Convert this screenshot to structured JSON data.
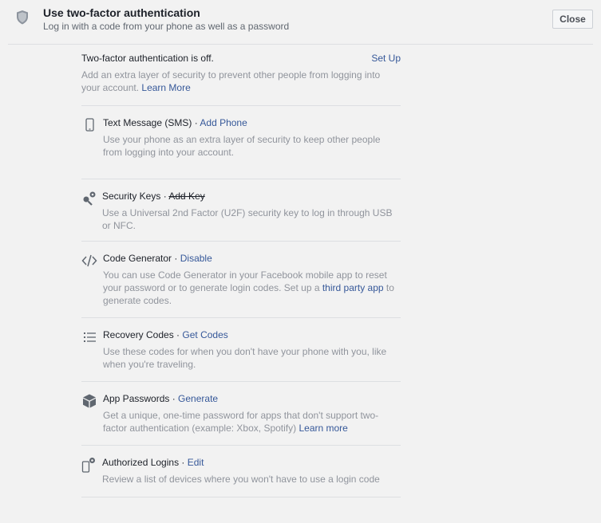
{
  "header": {
    "title": "Use two-factor authentication",
    "subtitle": "Log in with a code from your phone as well as a password",
    "close_label": "Close",
    "icon": "shield-icon"
  },
  "status": {
    "text": "Two-factor authentication is off.",
    "setup_label": "Set Up",
    "desc": "Add an extra layer of security to prevent other people from logging into your account.",
    "learn_more": "Learn More"
  },
  "methods": {
    "text_message": {
      "icon": "phone-icon",
      "title": "Text Message (SMS)",
      "sep": " · ",
      "action": "Add Phone",
      "desc": "Use your phone as an extra layer of security to keep other people from logging into your account."
    },
    "security_keys": {
      "icon": "key-icon",
      "title": "Security Keys",
      "sep": " · ",
      "action": "Add Key",
      "desc": "Use a Universal 2nd Factor (U2F) security key to log in through USB or NFC."
    },
    "code_generator": {
      "icon": "code-icon",
      "title": "Code Generator",
      "sep": " · ",
      "action": "Disable",
      "desc_before": "You can use Code Generator in your Facebook mobile app to reset your password or to generate login codes. Set up a ",
      "desc_link": "third party app",
      "desc_after": " to generate codes."
    },
    "recovery_codes": {
      "icon": "list-icon",
      "title": "Recovery Codes",
      "sep": " · ",
      "action": "Get Codes",
      "desc": "Use these codes for when you don't have your phone with you, like when you're traveling."
    },
    "app_passwords": {
      "icon": "cube-icon",
      "title": "App Passwords",
      "sep": " · ",
      "action": "Generate",
      "desc_before": "Get a unique, one-time password for apps that don't support two-factor authentication (example: Xbox, Spotify) ",
      "desc_link": "Learn more"
    },
    "authorized_logins": {
      "icon": "device-icon",
      "title": "Authorized Logins",
      "sep": " · ",
      "action": "Edit",
      "desc": "Review a list of devices where you won't have to use a login code"
    }
  }
}
